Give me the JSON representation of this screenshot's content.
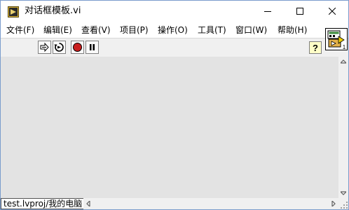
{
  "window": {
    "title": "对话框模板.vi"
  },
  "menubar": {
    "items": [
      "文件(F)",
      "编辑(E)",
      "查看(V)",
      "项目(P)",
      "操作(O)",
      "工具(T)",
      "窗口(W)",
      "帮助(H)"
    ]
  },
  "toolbar": {
    "help_symbol": "?"
  },
  "vi_icon": {
    "badge": "1"
  },
  "statusbar": {
    "context": "test.lvproj/我的电脑"
  },
  "colors": {
    "canvas": "#e3e3e3",
    "abort_red": "#c81e1e",
    "help_yellow": "#ffffc8"
  }
}
